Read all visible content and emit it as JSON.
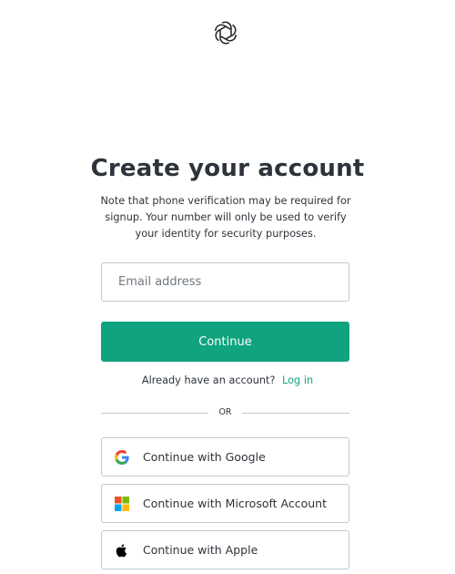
{
  "logo": {
    "icon": "openai-logo-icon"
  },
  "heading": {
    "title": "Create your account",
    "subtitle": "Note that phone verification may be required for signup. Your number will only be used to verify your identity for security purposes."
  },
  "form": {
    "email_placeholder": "Email address",
    "email_value": "",
    "continue_label": "Continue"
  },
  "login": {
    "prompt": "Already have an account?",
    "link_label": "Log in"
  },
  "divider": {
    "label": "OR"
  },
  "social": [
    {
      "label": "Continue with Google",
      "icon": "google-icon"
    },
    {
      "label": "Continue with Microsoft Account",
      "icon": "microsoft-icon"
    },
    {
      "label": "Continue with Apple",
      "icon": "apple-icon"
    }
  ],
  "colors": {
    "accent": "#10a37f",
    "border": "#c2c8d0",
    "text": "#2d333a"
  }
}
